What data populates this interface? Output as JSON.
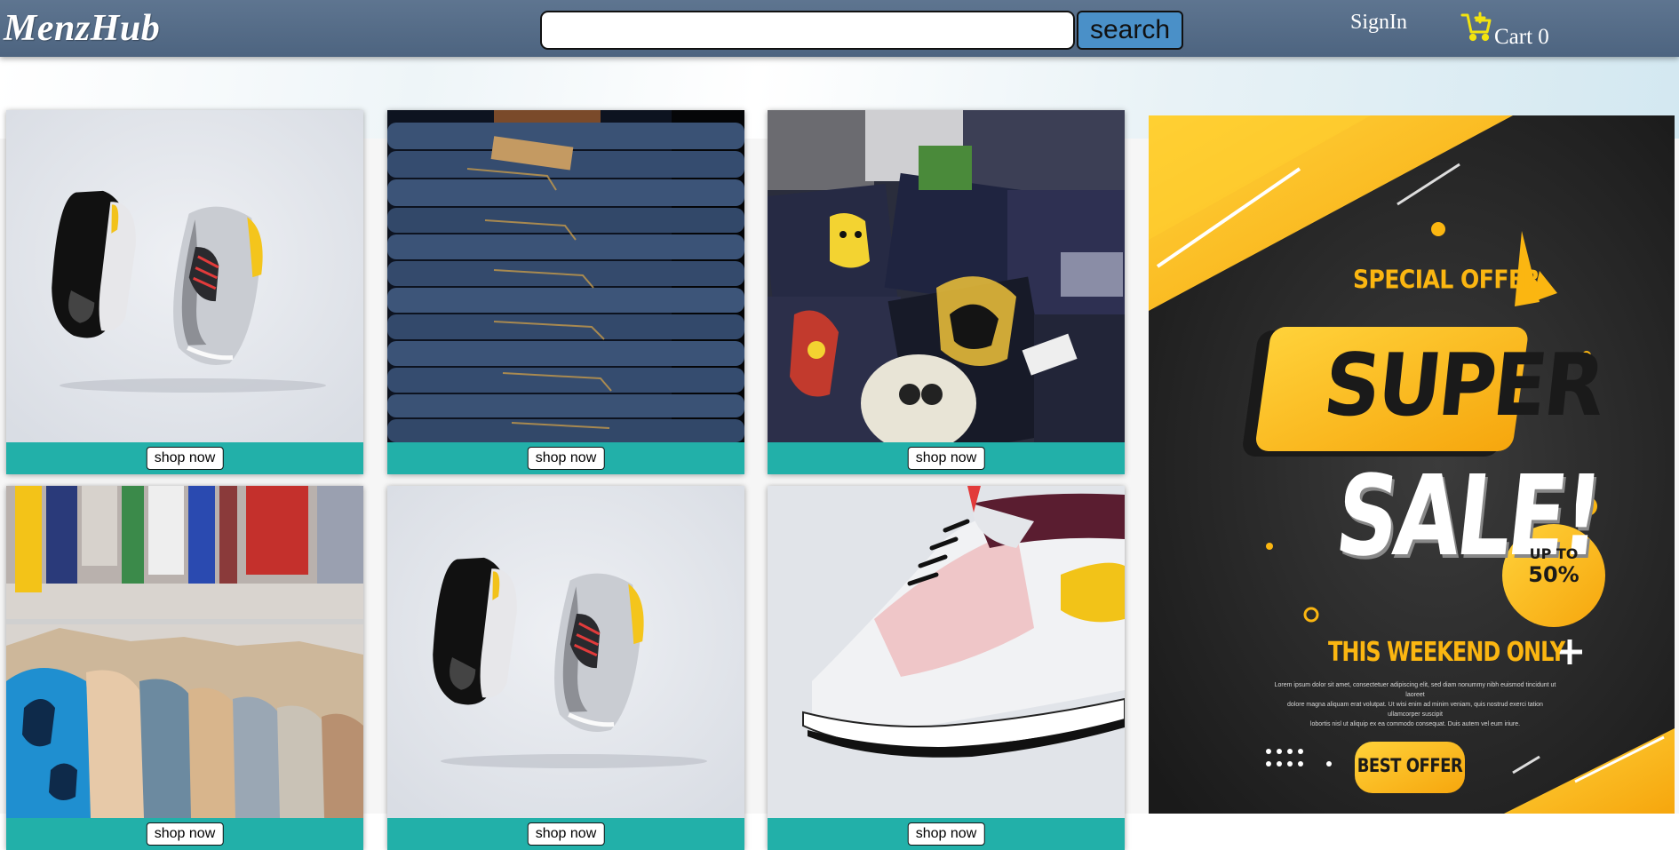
{
  "header": {
    "logo": "MenzHub",
    "search_placeholder": "",
    "search_label": "search",
    "signin_label": "SignIn",
    "cart_label": "Cart 0"
  },
  "products": [
    {
      "name": "sneakers-pair-grey-yellow",
      "button": "shop now"
    },
    {
      "name": "stacked-denim-jeans",
      "button": "shop now"
    },
    {
      "name": "graphic-tshirts-pile",
      "button": "shop now"
    },
    {
      "name": "shirts-on-rack",
      "button": "shop now"
    },
    {
      "name": "sneakers-pair-grey-yellow",
      "button": "shop now"
    },
    {
      "name": "white-running-shoe",
      "button": "shop now"
    }
  ],
  "ad_banner": {
    "eyebrow": "SPECIAL OFFER",
    "headline1": "SUPER",
    "headline2": "SALE!",
    "badge_line1": "UP TO",
    "badge_line2": "50%",
    "subline": "THIS WEEKEND ONLY",
    "body_line1": "Lorem ipsum dolor sit amet, consectetuer adipiscing elit, sed diam nonummy nibh euismod tincidunt ut laoreet",
    "body_line2": "dolore magna aliquam erat volutpat. Ut wisi enim ad minim veniam, quis nostrud exerci tation ullamcorper suscipit",
    "body_line3": "lobortis nisl ut aliquip ex ea commodo consequat. Duis autem vel eum iriure.",
    "cta": "BEST OFFER"
  },
  "colors": {
    "navbar": "#576e8a",
    "search_button": "#4a90c8",
    "card_bar": "#22b0a9",
    "cart_icon": "#f2e30f",
    "ad_yellow": "#fbb611",
    "ad_dark": "#1f1f1f"
  },
  "icons": {
    "cart": "shopping-cart-add-icon"
  }
}
